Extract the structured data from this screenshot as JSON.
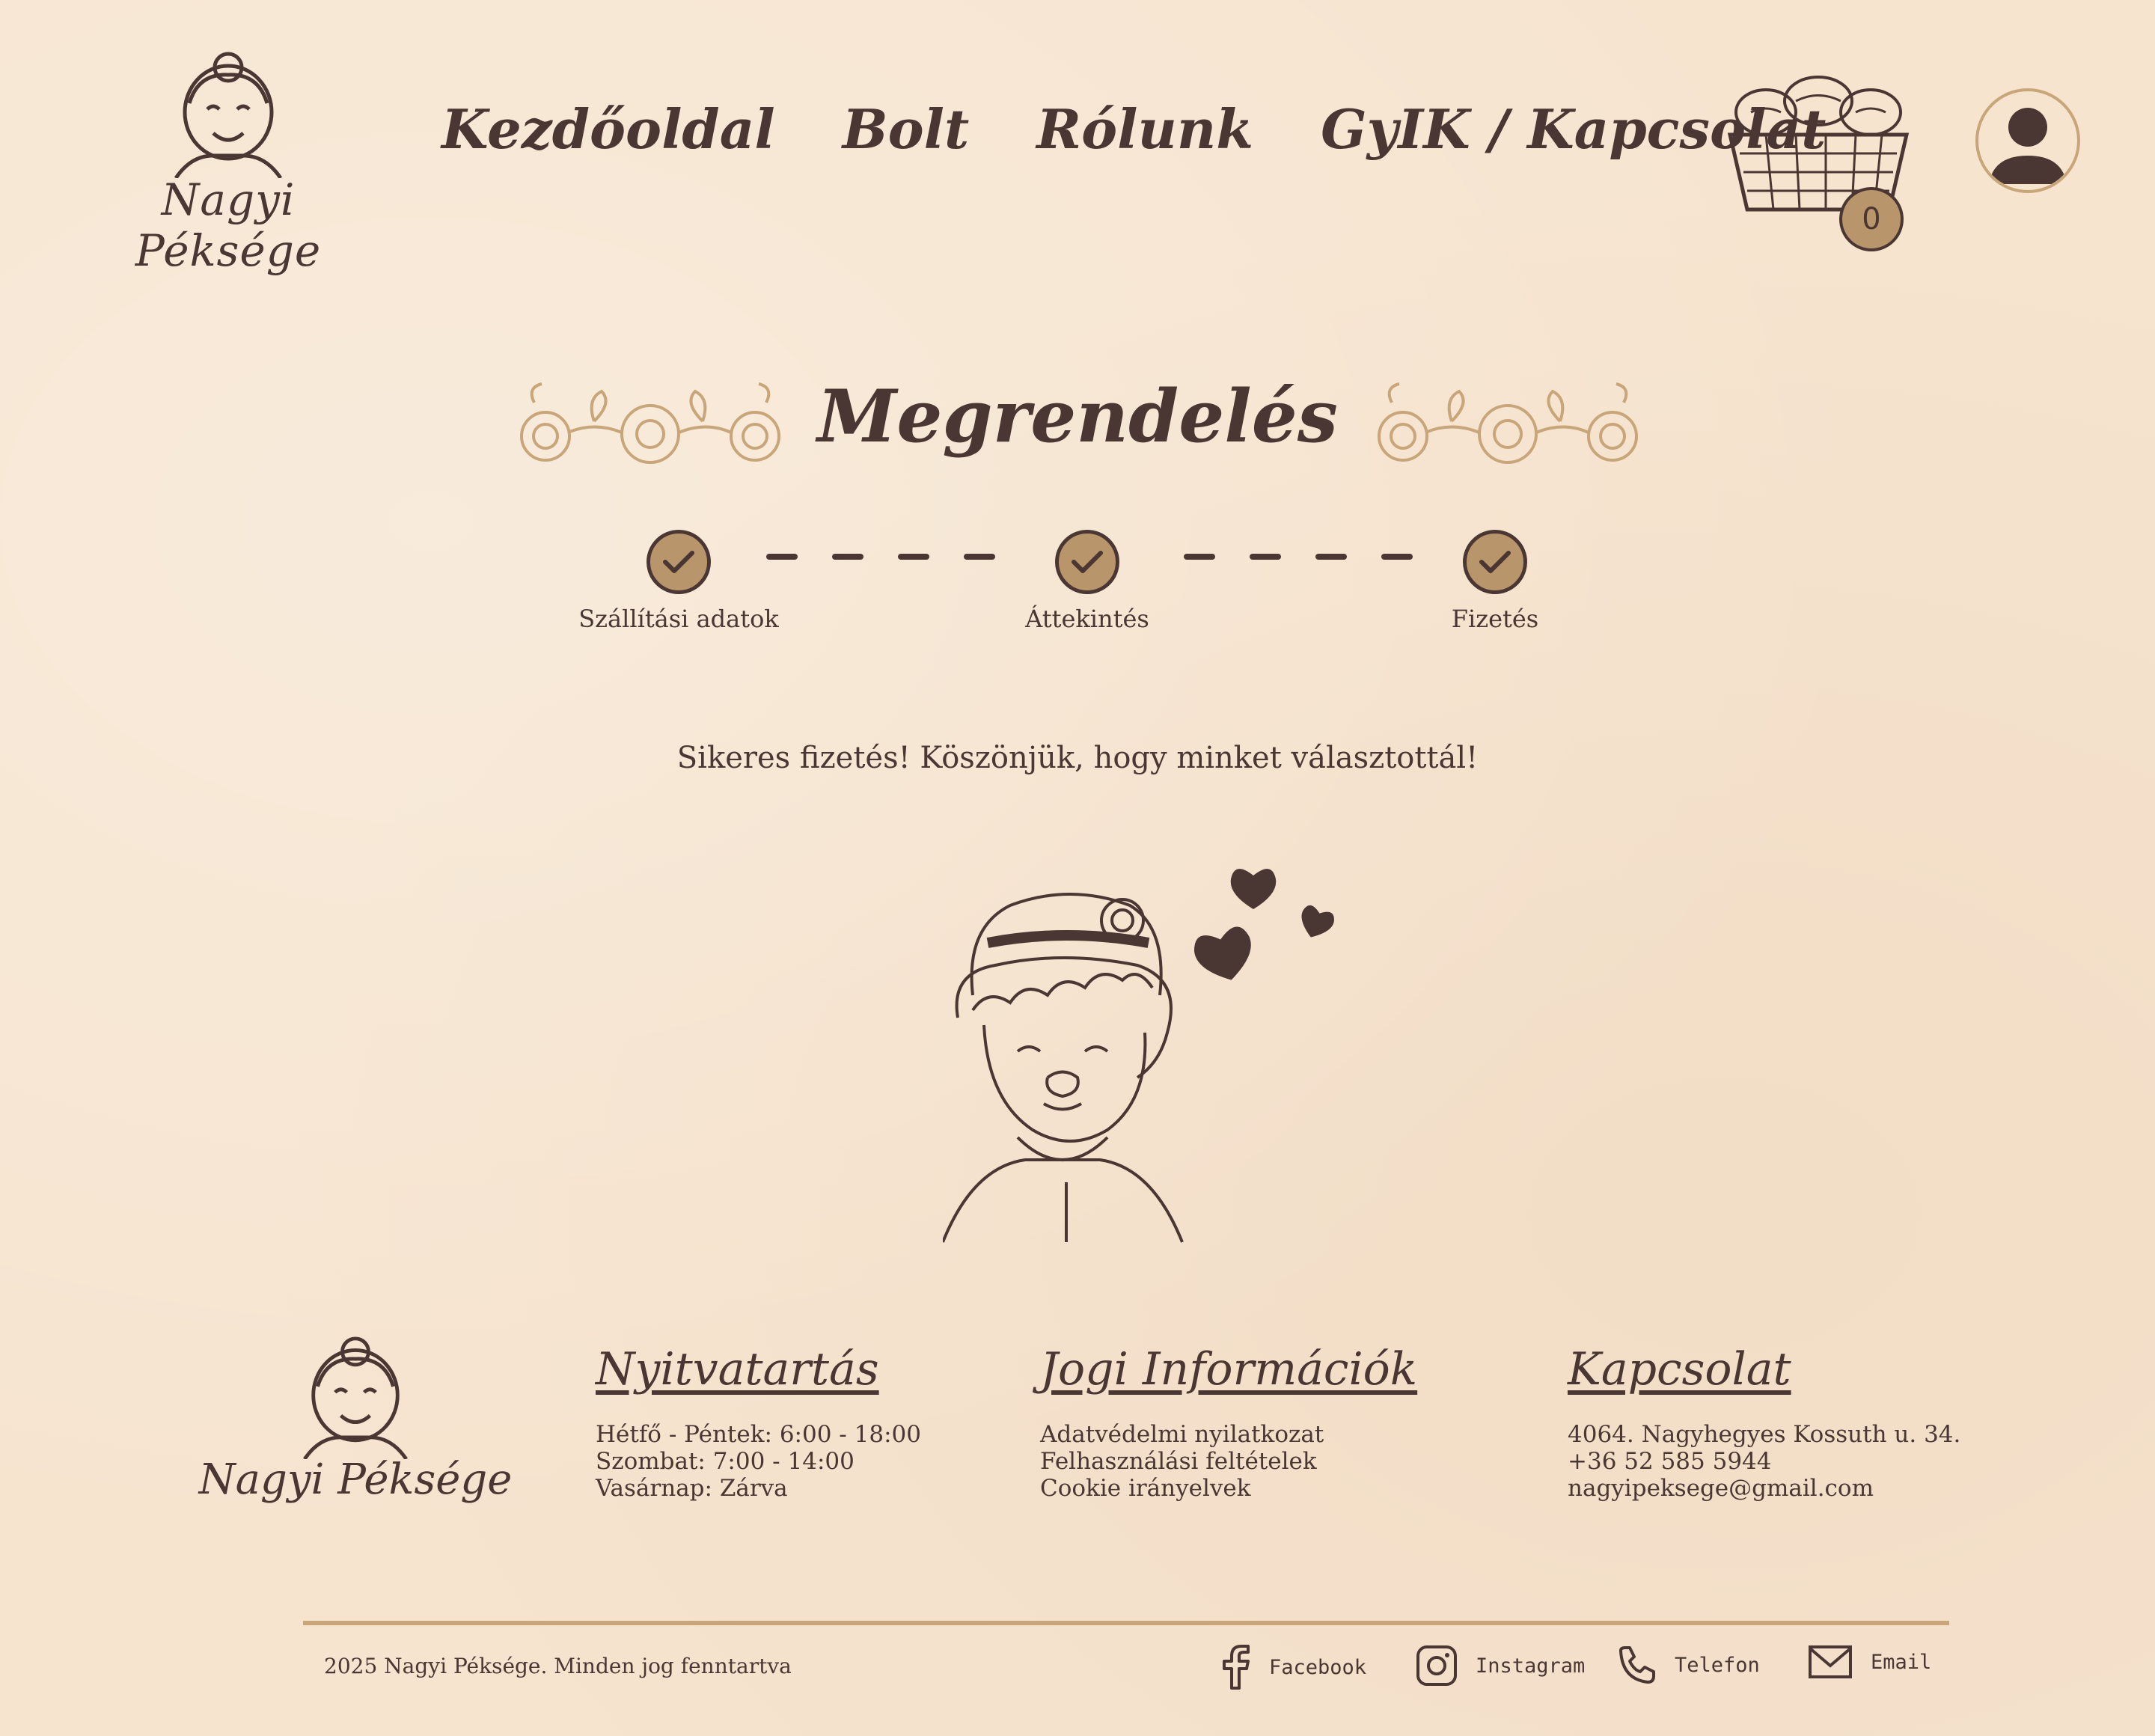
{
  "header": {
    "logo_text": "Nagyi Péksége",
    "nav": [
      "Kezdőoldal",
      "Bolt",
      "Rólunk",
      "GyIK / Kapcsolat"
    ],
    "cart_count": "0"
  },
  "page": {
    "title": "Megrendelés",
    "steps": [
      "Szállítási adatok",
      "Áttekintés",
      "Fizetés"
    ],
    "success_message": "Sikeres fizetés! Köszönjük, hogy minket választottál!"
  },
  "footer": {
    "logo_text": "Nagyi Péksége",
    "hours": {
      "title": "Nyitvatartás",
      "lines": [
        "Hétfő - Péntek: 6:00 - 18:00",
        "Szombat: 7:00 - 14:00",
        "Vasárnap: Zárva"
      ]
    },
    "legal": {
      "title": "Jogi Információk",
      "lines": [
        "Adatvédelmi nyilatkozat",
        "Felhasználási feltételek",
        "Cookie irányelvek"
      ]
    },
    "contact": {
      "title": "Kapcsolat",
      "lines": [
        "4064. Nagyhegyes Kossuth u. 34.",
        "+36 52 585 5944",
        "nagyipeksege@gmail.com"
      ]
    },
    "copyright": "2025 Nagyi Péksége. Minden jog fenntartva",
    "social": [
      "Facebook",
      "Instagram",
      "Telefon",
      "Email"
    ]
  },
  "colors": {
    "ink": "#4a3632",
    "accent": "#b8956a",
    "background": "#f6e4cf",
    "divider": "#c9a67a"
  }
}
